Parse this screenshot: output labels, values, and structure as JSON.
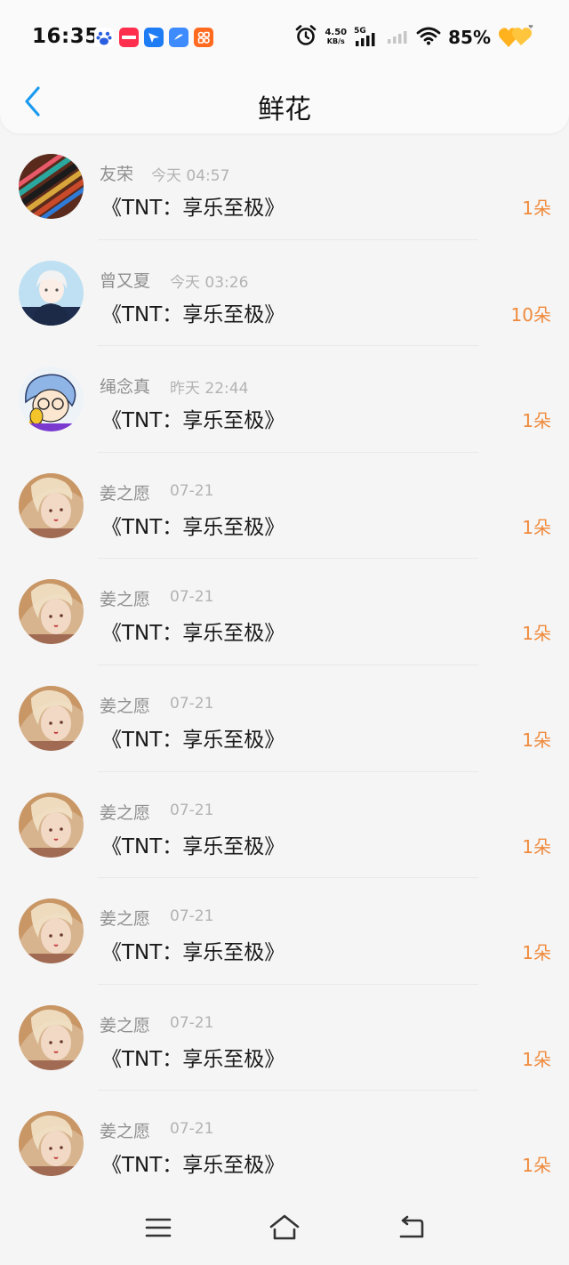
{
  "status_bar": {
    "time": "16:35",
    "net_speed_value": "4.50",
    "net_speed_unit": "KB/s",
    "network_type": "5G",
    "battery": "85%",
    "app_icons": [
      {
        "icon": "baidu-icon",
        "color": "#ffffff"
      },
      {
        "icon": "xiaohongshu-icon",
        "color": "#ff2e4d"
      },
      {
        "icon": "feishu-icon",
        "color": "#1e7cf5"
      },
      {
        "icon": "app-blue-icon",
        "color": "#3d8bfd"
      },
      {
        "icon": "app-orange-icon",
        "color": "#ff6a1f"
      }
    ]
  },
  "header": {
    "title": "鲜花",
    "back_icon": "chevron-left-icon"
  },
  "colors": {
    "accent": "#1a9bf0",
    "count": "#f08a3c",
    "name": "#8f8f8f",
    "time": "#b3b3b3"
  },
  "items": [
    {
      "name": "友荣",
      "time": "今天 04:57",
      "title": "《TNT：享乐至极》",
      "count": "1朵",
      "avatar": "flutes"
    },
    {
      "name": "曾又夏",
      "time": "今天 03:26",
      "title": "《TNT：享乐至极》",
      "count": "10朵",
      "avatar": "anime-boy"
    },
    {
      "name": "绳念真",
      "time": "昨天 22:44",
      "title": "《TNT：享乐至极》",
      "count": "1朵",
      "avatar": "cartoon"
    },
    {
      "name": "姜之愿",
      "time": "07-21",
      "title": "《TNT：享乐至极》",
      "count": "1朵",
      "avatar": "girl"
    },
    {
      "name": "姜之愿",
      "time": "07-21",
      "title": "《TNT：享乐至极》",
      "count": "1朵",
      "avatar": "girl"
    },
    {
      "name": "姜之愿",
      "time": "07-21",
      "title": "《TNT：享乐至极》",
      "count": "1朵",
      "avatar": "girl"
    },
    {
      "name": "姜之愿",
      "time": "07-21",
      "title": "《TNT：享乐至极》",
      "count": "1朵",
      "avatar": "girl"
    },
    {
      "name": "姜之愿",
      "time": "07-21",
      "title": "《TNT：享乐至极》",
      "count": "1朵",
      "avatar": "girl"
    },
    {
      "name": "姜之愿",
      "time": "07-21",
      "title": "《TNT：享乐至极》",
      "count": "1朵",
      "avatar": "girl"
    },
    {
      "name": "姜之愿",
      "time": "07-21",
      "title": "《TNT：享乐至极》",
      "count": "1朵",
      "avatar": "girl"
    }
  ],
  "nav_bar": {
    "buttons": [
      "menu-icon",
      "home-icon",
      "back-icon"
    ]
  }
}
